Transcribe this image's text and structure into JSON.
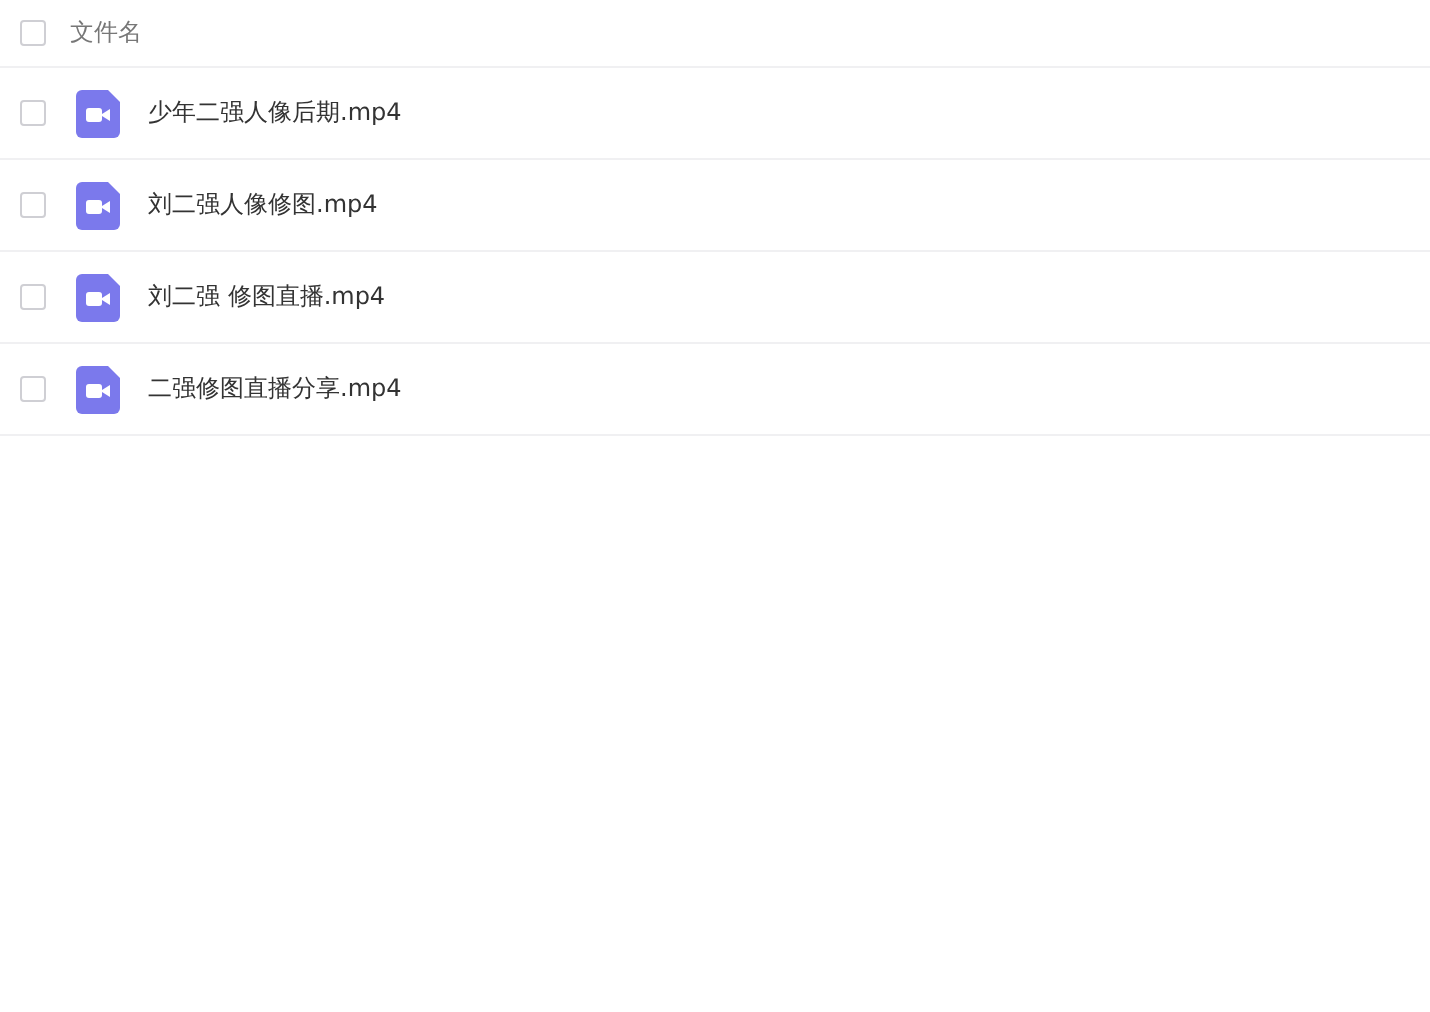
{
  "header": {
    "checked": false,
    "label": "文件名"
  },
  "files": [
    {
      "name": "少年二强人像后期.mp4",
      "checked": false
    },
    {
      "name": "刘二强人像修图.mp4",
      "checked": false
    },
    {
      "name": "刘二强 修图直播.mp4",
      "checked": false
    },
    {
      "name": "二强修图直播分享.mp4",
      "checked": false
    }
  ]
}
